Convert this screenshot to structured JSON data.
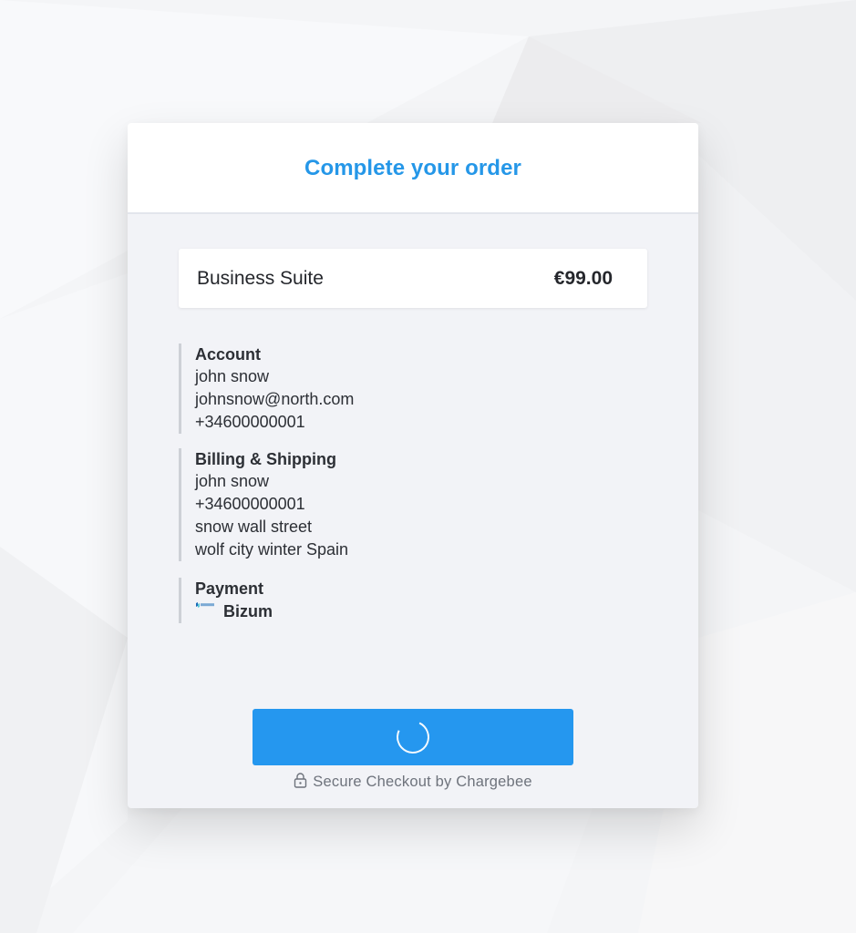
{
  "header": {
    "title": "Complete your order"
  },
  "product": {
    "name": "Business Suite",
    "price": "€99.00"
  },
  "account": {
    "title": "Account",
    "name": "john snow",
    "email": "johnsnow@north.com",
    "phone": "+34600000001"
  },
  "billing": {
    "title": "Billing & Shipping",
    "name": "john snow",
    "phone": "+34600000001",
    "street": "snow wall street",
    "city_line": "wolf city winter Spain"
  },
  "payment": {
    "title": "Payment",
    "method": "Bizum",
    "logo_text": "bizum"
  },
  "footer": {
    "secure_text": "Secure Checkout by Chargebee"
  },
  "colors": {
    "accent": "#2597e8",
    "button": "#2597ef",
    "text": "#25272c",
    "muted": "#6e737c"
  },
  "icons": [
    "bizum-logo-icon",
    "spinner-icon",
    "lock-icon"
  ]
}
